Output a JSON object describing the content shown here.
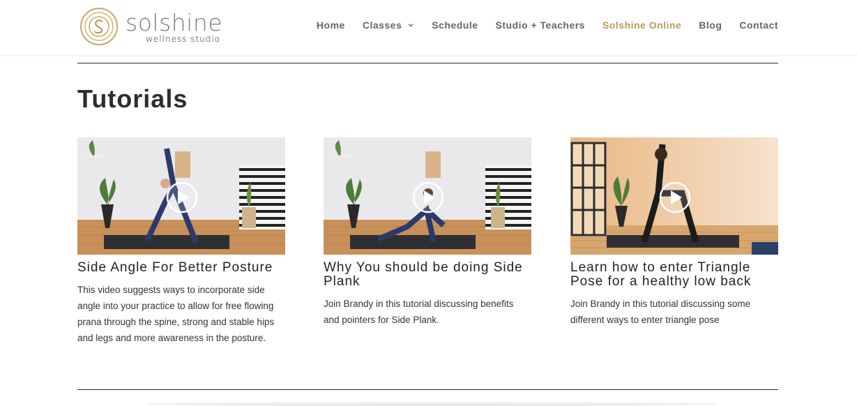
{
  "brand": {
    "name": "solshine",
    "tagline": "wellness studio",
    "accent_color": "#b99a58"
  },
  "nav": {
    "items": [
      {
        "label": "Home"
      },
      {
        "label": "Classes",
        "has_dropdown": true
      },
      {
        "label": "Schedule"
      },
      {
        "label": "Studio + Teachers"
      },
      {
        "label": "Solshine Online",
        "active": true
      },
      {
        "label": "Blog"
      },
      {
        "label": "Contact"
      }
    ]
  },
  "main": {
    "section_title": "Tutorials",
    "tutorials": [
      {
        "title": "Side Angle For Better Posture",
        "description": "This video suggests ways to incorporate side angle into your practice to allow for free flowing prana through the spine, strong and stable hips and legs and more awareness in the posture.",
        "thumbnail_icon": "play-icon"
      },
      {
        "title": "Why You should be doing Side Plank",
        "description": "Join Brandy in this tutorial discussing benefits and pointers for Side Plank.",
        "thumbnail_icon": "play-icon"
      },
      {
        "title": "Learn how to enter Triangle Pose for a healthy low back",
        "description": "Join Brandy in this tutorial discussing some different ways to enter triangle pose",
        "thumbnail_icon": "play-icon"
      }
    ]
  }
}
